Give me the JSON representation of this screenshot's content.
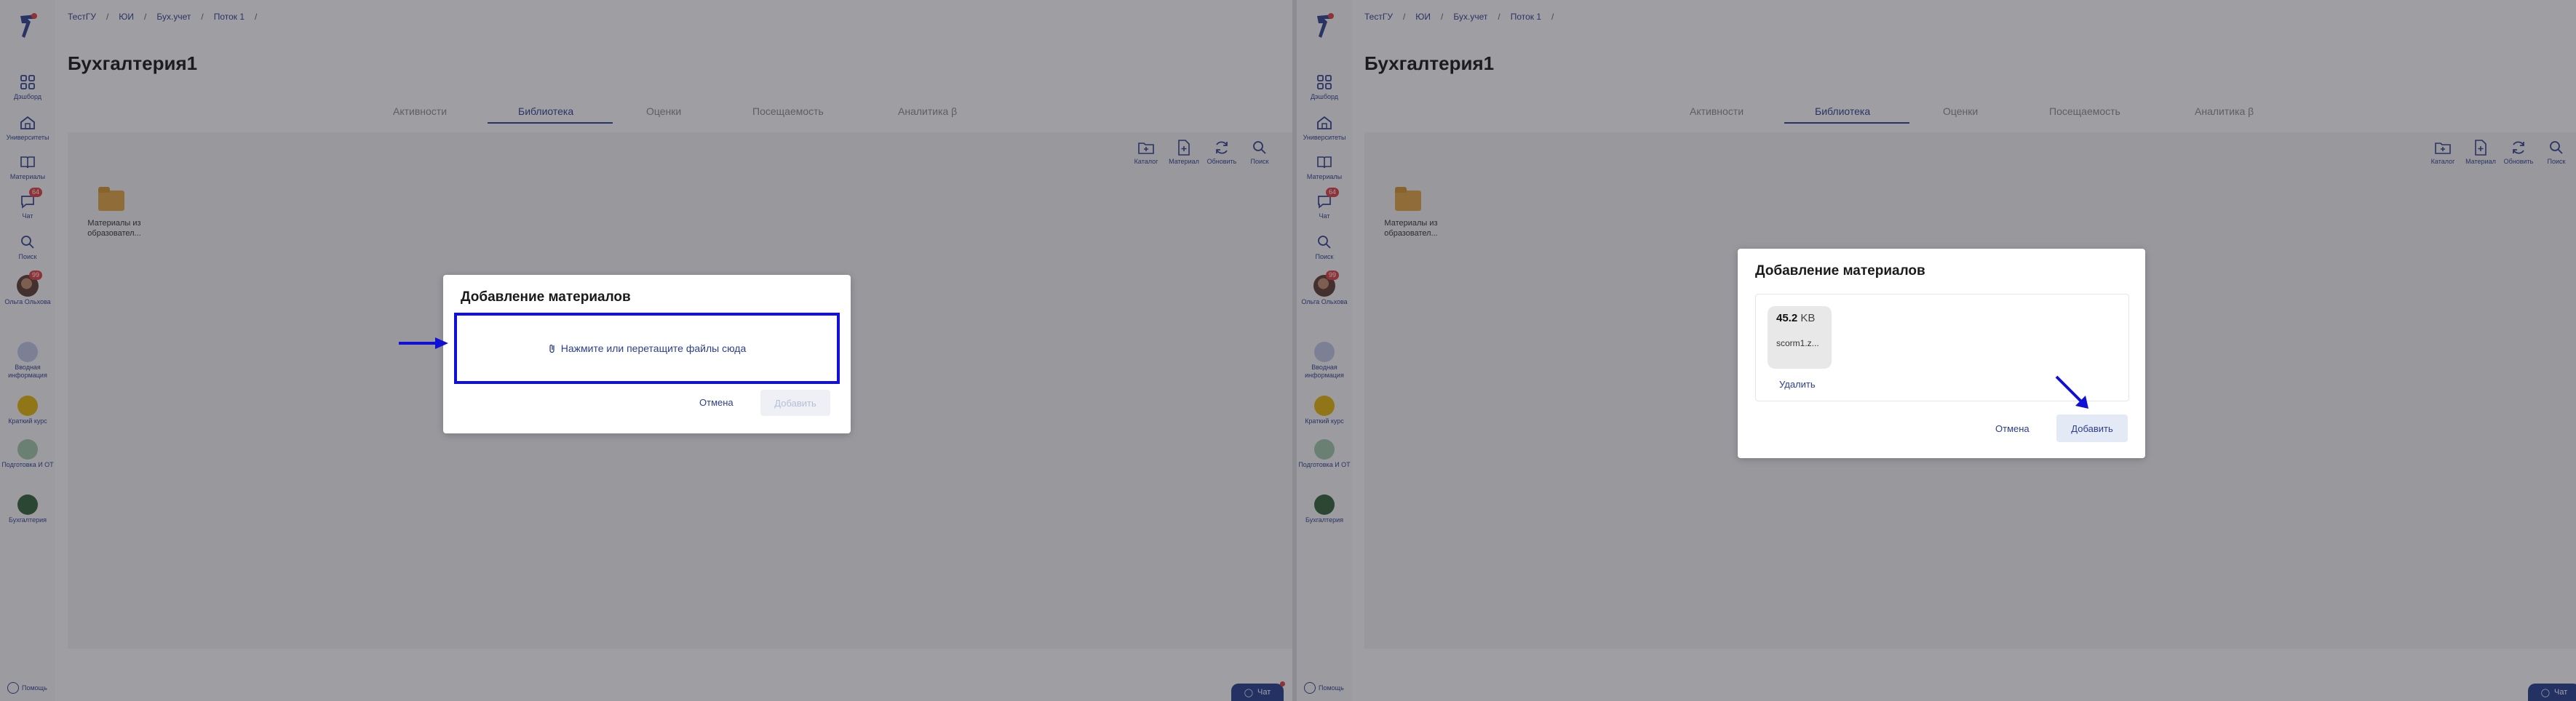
{
  "app": {
    "breadcrumb": [
      "ТестГУ",
      "ЮИ",
      "Бух.учет",
      "Поток 1"
    ],
    "page_title": "Бухгалтерия1",
    "tabs": [
      {
        "label": "Активности",
        "active": false
      },
      {
        "label": "Библиотека",
        "active": true
      },
      {
        "label": "Оценки",
        "active": false
      },
      {
        "label": "Посещаемость",
        "active": false
      },
      {
        "label": "Аналитика β",
        "active": false
      }
    ],
    "sidebar": [
      {
        "label": "Дэшборд",
        "icon": "dashboard-icon"
      },
      {
        "label": "Университеты",
        "icon": "university-icon"
      },
      {
        "label": "Материалы",
        "icon": "book-icon"
      },
      {
        "label": "Чат",
        "icon": "chat-icon",
        "badge": "64"
      },
      {
        "label": "Поиск",
        "icon": "search-icon"
      },
      {
        "label": "Ольга Ольхова",
        "icon": "user-avatar",
        "badge": "99"
      },
      {
        "label": "Вводная информация",
        "icon": "intro-course-icon"
      },
      {
        "label": "Краткий курс",
        "icon": "short-course-icon"
      },
      {
        "label": "Подготовка И ОТ",
        "icon": "prep-course-icon"
      },
      {
        "label": "Бухгалтерия",
        "icon": "accounting-course-icon"
      }
    ],
    "toolbar": [
      {
        "label": "Каталог",
        "icon": "folder-plus-icon"
      },
      {
        "label": "Материал",
        "icon": "file-plus-icon"
      },
      {
        "label": "Обновить",
        "icon": "refresh-icon"
      },
      {
        "label": "Поиск",
        "icon": "search-icon"
      }
    ],
    "folder": {
      "label": "Материалы из образовател..."
    },
    "help_label": "Помощь",
    "chat_label": "Чат",
    "colors": {
      "primary": "#2c3e8c",
      "highlight": "#1010d8",
      "folder": "#e4a53c"
    }
  },
  "left_modal": {
    "title": "Добавление материалов",
    "dropzone_text": "Нажмите или перетащите файлы сюда",
    "cancel": "Отмена",
    "add": "Добавить"
  },
  "right_modal": {
    "title": "Добавление материалов",
    "file_size": "45.2",
    "file_unit": "KB",
    "file_name": "scorm1.z...",
    "remove": "Удалить",
    "cancel": "Отмена",
    "add": "Добавить"
  }
}
